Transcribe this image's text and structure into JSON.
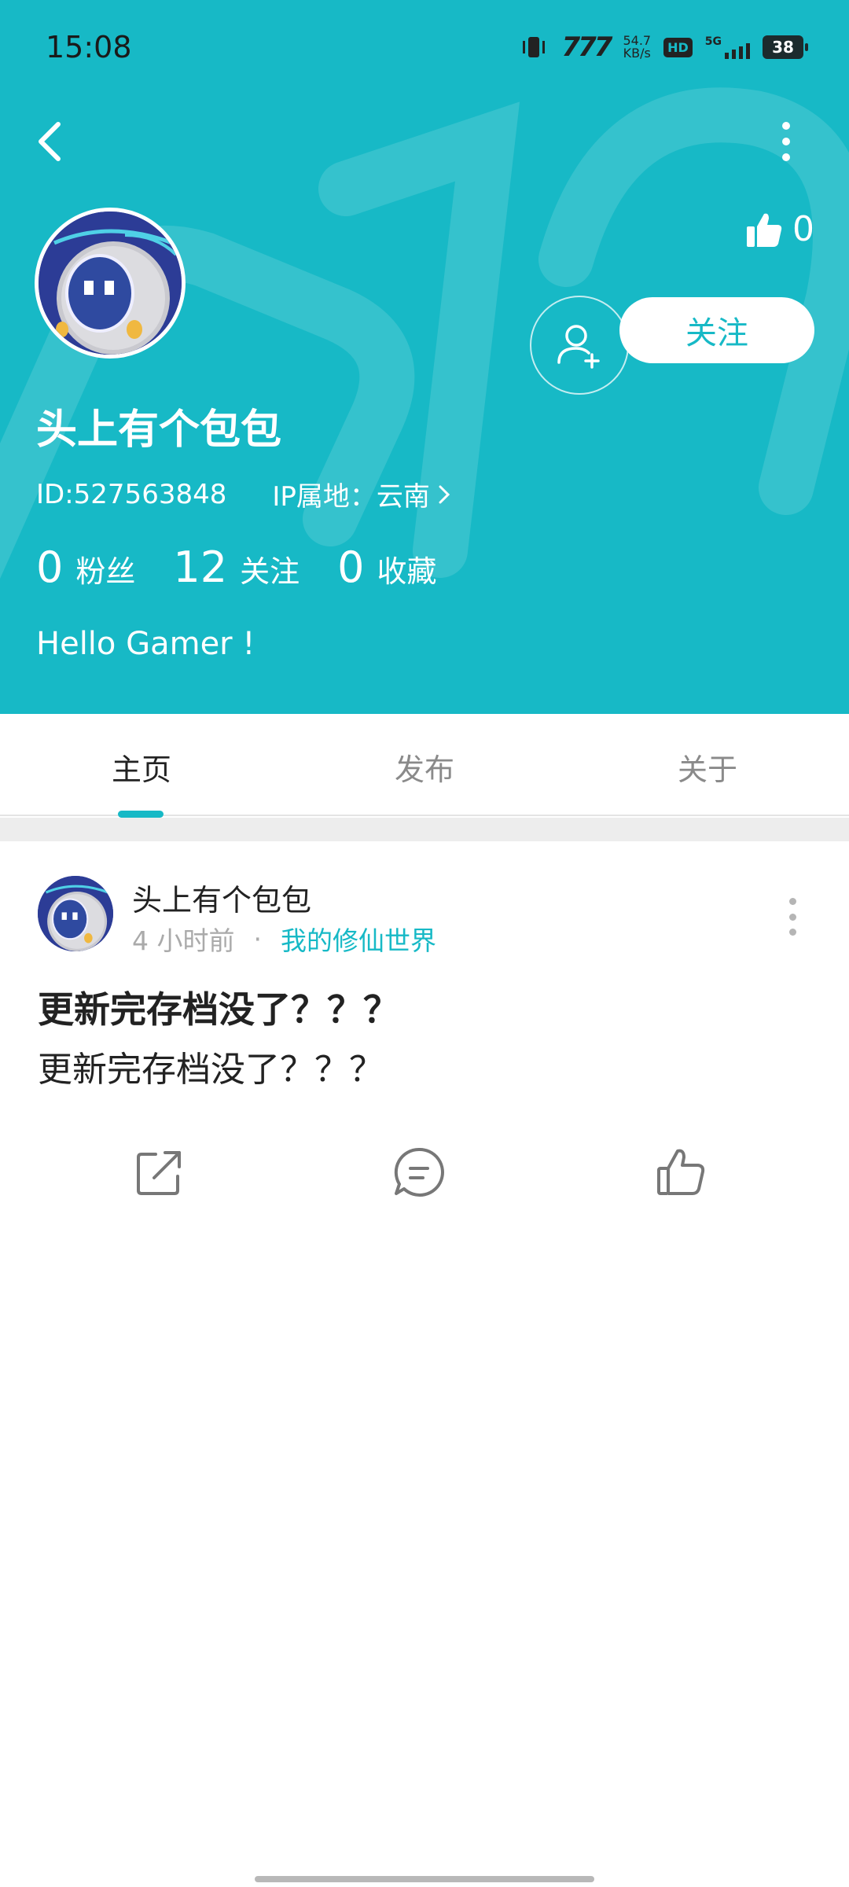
{
  "status_bar": {
    "time": "15:08",
    "network_speed_value": "54.7",
    "network_speed_unit": "KB/s",
    "hd_label": "HD",
    "network_type": "5G",
    "battery": "38"
  },
  "profile": {
    "username": "头上有个包包",
    "id_text": "ID:527563848",
    "ip_text": "IP属地：云南",
    "like_count": "0",
    "follow_label": "关注",
    "stats": [
      {
        "num": "0",
        "label": "粉丝"
      },
      {
        "num": "12",
        "label": "关注"
      },
      {
        "num": "0",
        "label": "收藏"
      }
    ],
    "bio": "Hello Gamer !"
  },
  "tabs": [
    {
      "label": "主页",
      "active": true
    },
    {
      "label": "发布",
      "active": false
    },
    {
      "label": "关于",
      "active": false
    }
  ],
  "post": {
    "author": "头上有个包包",
    "time": "4 小时前",
    "separator": "·",
    "game": "我的修仙世界",
    "title": "更新完存档没了？？？",
    "body": "更新完存档没了？？？"
  },
  "colors": {
    "accent": "#17b9c6",
    "text": "#222222",
    "muted": "#aaaaaa"
  },
  "icons": [
    "back-icon",
    "more-icon",
    "thumbs-up-icon",
    "add-friend-icon",
    "share-icon",
    "comment-icon",
    "like-icon"
  ]
}
